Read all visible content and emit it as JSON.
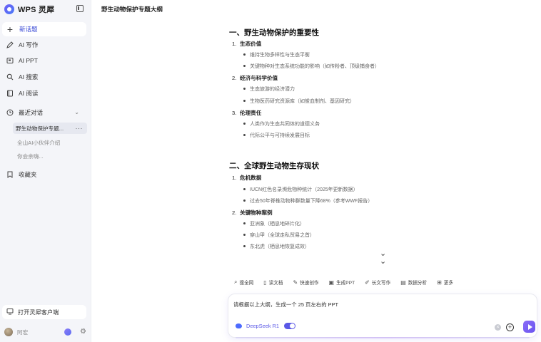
{
  "brand": {
    "name": "WPS 灵犀"
  },
  "sidebar": {
    "new_chat": "新话题",
    "items": [
      {
        "label": "AI 写作",
        "icon": "pen-icon"
      },
      {
        "label": "AI PPT",
        "icon": "ppt-icon"
      },
      {
        "label": "AI 搜索",
        "icon": "search-icon"
      },
      {
        "label": "AI 阅读",
        "icon": "book-icon"
      }
    ],
    "recent_label": "最近对话",
    "recent": [
      {
        "label": "野生动物保护专题...",
        "active": true
      },
      {
        "label": "全山AI小伙伴介绍",
        "active": false
      },
      {
        "label": "你会余嗨...",
        "active": false
      }
    ],
    "favorites_label": "收藏夹",
    "client_button": "打开灵犀客户端",
    "user_name": "阿宏"
  },
  "doc": {
    "title": "野生动物保护专题大纲",
    "sections": [
      {
        "heading": "一、野生动物保护的重要性",
        "subsections": [
          {
            "num": "1.",
            "title": "生态价值",
            "bullets": [
              "维持生物多样性与生态平衡",
              "关键物种对生态系统功能的影响（如传粉者、顶级捕食者）"
            ]
          },
          {
            "num": "2.",
            "title": "经济与科学价值",
            "bullets": [
              "生态旅游的经济潜力",
              "生物医药研究资源库（如鲎血制剂、基因研究）"
            ]
          },
          {
            "num": "3.",
            "title": "伦理责任",
            "bullets": [
              "人类作为生态共同体的道德义务",
              "代际公平与可持续发展目标"
            ]
          }
        ]
      },
      {
        "heading": "二、全球野生动物生存现状",
        "subsections": [
          {
            "num": "1.",
            "title": "危机数据",
            "bullets": [
              "IUCN红色名录濒危物种统计（2025年更新数据）",
              "过去50年脊椎动物种群数量下降68%（参考WWF报告）"
            ]
          },
          {
            "num": "2.",
            "title": "关键物种案例",
            "bullets": [
              "亚洲象（栖息地碎片化）",
              "穿山甲（全球走私贸易之首）",
              "东北虎（栖息地恢复成效）"
            ]
          }
        ]
      }
    ]
  },
  "toolbar": {
    "items": [
      {
        "label": "搜全网",
        "icon": "search-icon"
      },
      {
        "label": "读文档",
        "icon": "doc-icon"
      },
      {
        "label": "快速创作",
        "icon": "magic-icon"
      },
      {
        "label": "生成PPT",
        "icon": "ppt-icon"
      },
      {
        "label": "长文写作",
        "icon": "pen-icon"
      },
      {
        "label": "数据分析",
        "icon": "chart-icon"
      },
      {
        "label": "更多",
        "icon": "grid-icon"
      }
    ]
  },
  "input": {
    "value": "请根据以上大纲，生成一个 25 页左右的 PPT",
    "model": "DeepSeek R1",
    "model_enabled": true
  },
  "colors": {
    "accent": "#5a58e6",
    "sidebar_bg": "#f4f5f9"
  }
}
